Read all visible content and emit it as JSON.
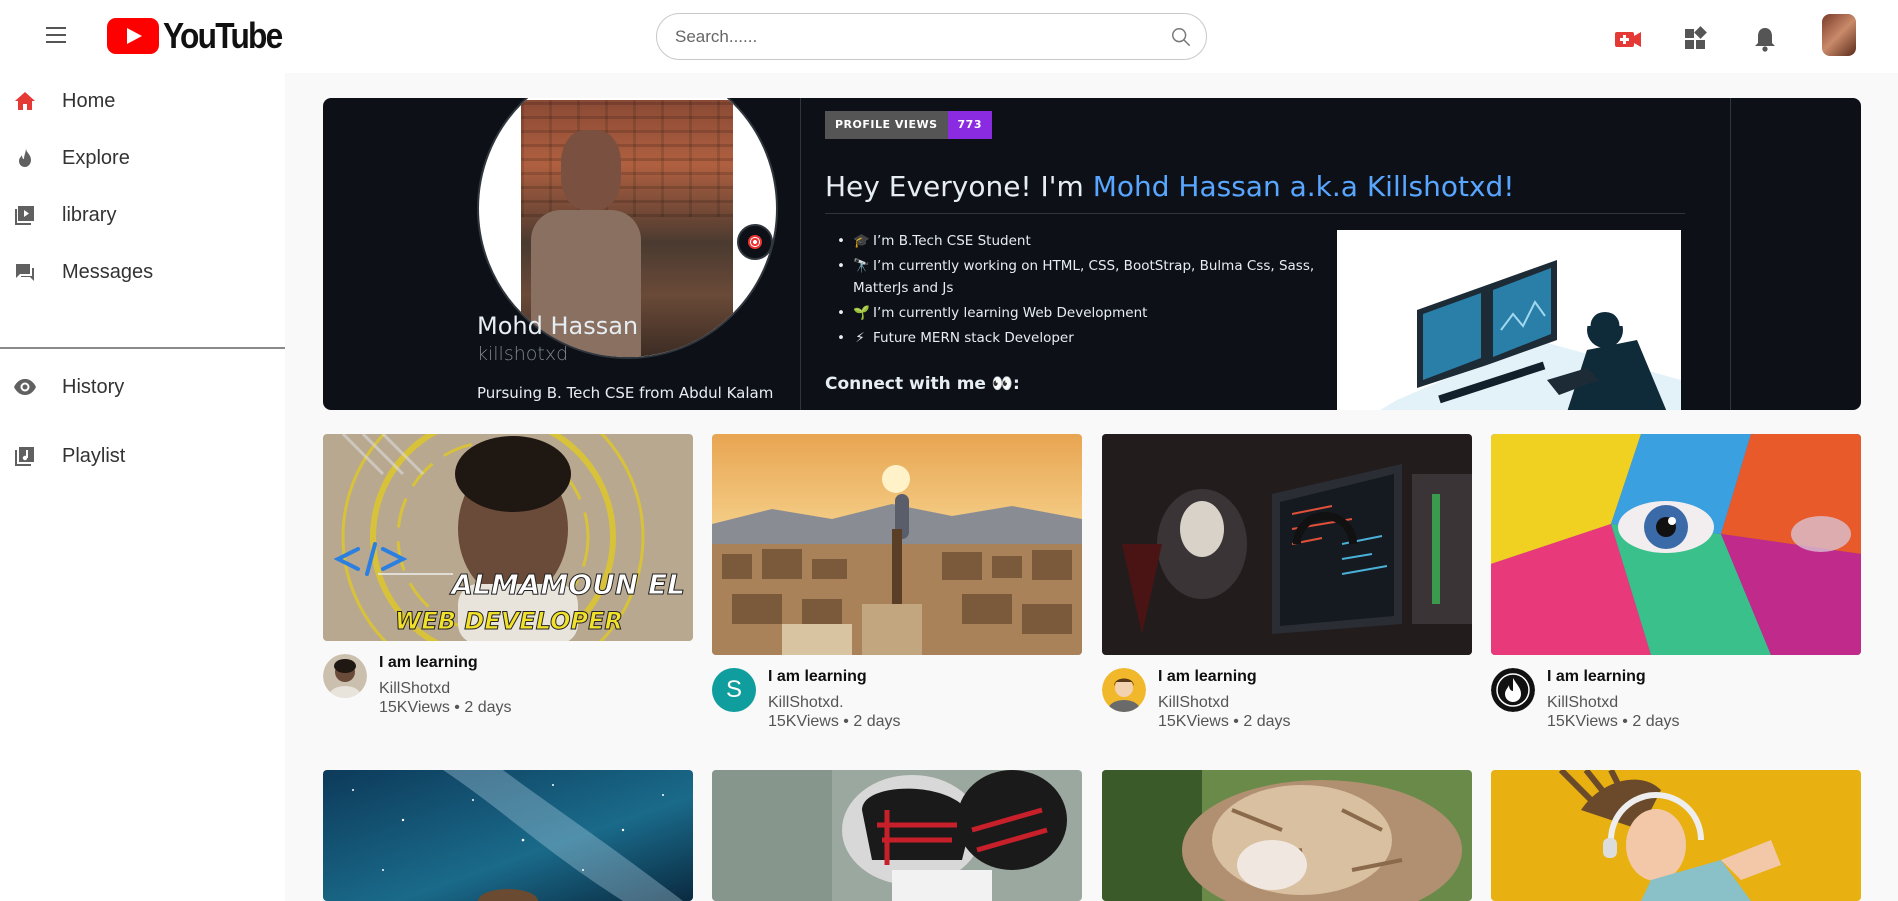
{
  "header": {
    "logo_text": "YouTube",
    "search_placeholder": "Search......"
  },
  "sidebar": {
    "items": [
      {
        "label": "Home",
        "icon": "home-icon"
      },
      {
        "label": "Explore",
        "icon": "explore-icon"
      },
      {
        "label": "library",
        "icon": "library-icon"
      },
      {
        "label": "Messages",
        "icon": "messages-icon"
      },
      {
        "label": "History",
        "icon": "history-icon"
      },
      {
        "label": "Playlist",
        "icon": "playlist-icon"
      }
    ]
  },
  "banner": {
    "profile_name": "Mohd Hassan",
    "profile_handle": "killshotxd",
    "profile_bio": "Pursuing B. Tech CSE from Abdul Kalam",
    "views_label": "PROFILE VIEWS",
    "views_count": "773",
    "greeting_prefix": "Hey Everyone! I'm ",
    "greeting_name": "Mohd Hassan a.k.a Killshotxd!",
    "bullets": [
      "I’m B.Tech CSE Student",
      "I’m currently working on HTML, CSS, BootStrap, Bulma Css, Sass, MatterJs and Js",
      "I’m currently learning Web Development",
      "Future MERN stack Developer"
    ],
    "bullet_emojis": [
      "🎓",
      "🔭",
      "🌱",
      "⚡"
    ],
    "connect": "Connect with me 👀:"
  },
  "videos": [
    {
      "title": "I am learning",
      "channel": "KillShotxd",
      "stats": "15KViews • 2 days",
      "thumb_overlay_top": "ALMAMOUN EL",
      "thumb_overlay_bottom": "WEB DEVELOPER",
      "avatar_letter": ""
    },
    {
      "title": "I am learning",
      "channel": "KillShotxd.",
      "stats": "15KViews • 2 days",
      "avatar_letter": "S"
    },
    {
      "title": "I am learning",
      "channel": "KillShotxd",
      "stats": "15KViews • 2 days",
      "avatar_letter": ""
    },
    {
      "title": "I am learning",
      "channel": "KillShotxd",
      "stats": "15KViews • 2 days",
      "avatar_letter": ""
    }
  ],
  "colors": {
    "brand_red": "#ff0000",
    "banner_bg": "#0d1117",
    "link_blue": "#58a6ff",
    "badge_purple": "#8a2be2",
    "avatar_teal": "#0f9d9d"
  }
}
